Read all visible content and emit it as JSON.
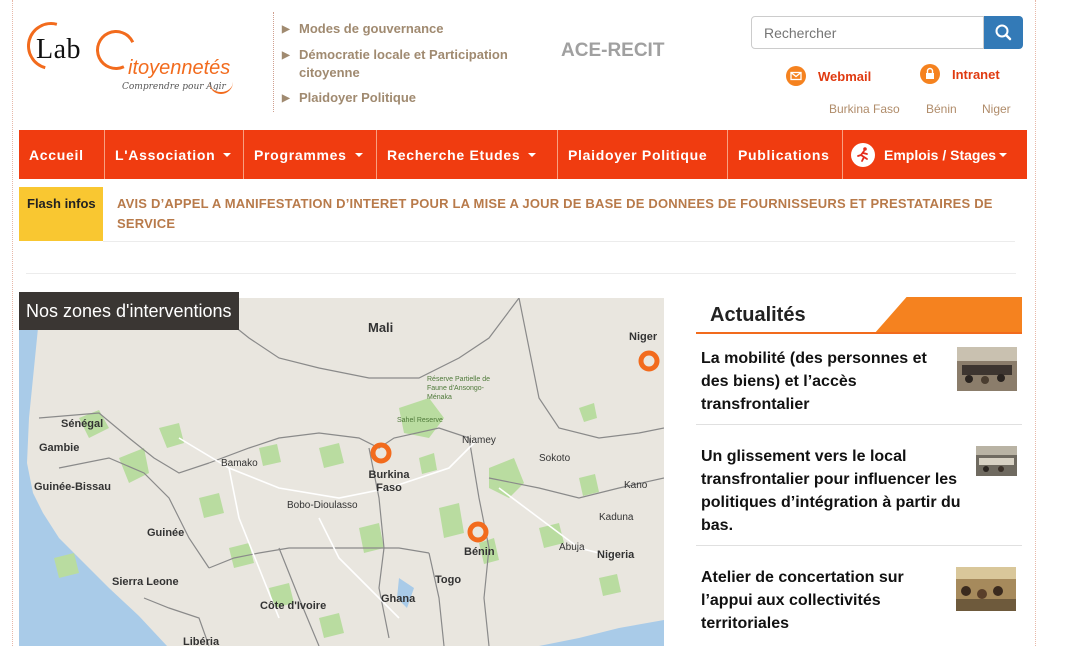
{
  "brand": {
    "logo_lab": "Lab",
    "logo_citoyennetes": "itoyennetés",
    "logo_tagline": "Comprendre pour Agir"
  },
  "top_links": [
    {
      "label": "Modes de gouvernance"
    },
    {
      "label": "Démocratie locale et Participation citoyenne"
    },
    {
      "label": "Plaidoyer Politique"
    }
  ],
  "ace_recit": "ACE-RECIT",
  "search": {
    "placeholder": "Rechercher",
    "icon": "search-icon"
  },
  "webmail": "Webmail",
  "intranet": "Intranet",
  "countries": [
    "Burkina Faso",
    "Bénin",
    "Niger"
  ],
  "nav": {
    "items": [
      {
        "label": "Accueil",
        "dropdown": false
      },
      {
        "label": "L'Association",
        "dropdown": true
      },
      {
        "label": "Programmes",
        "dropdown": true
      },
      {
        "label": "Recherche Etudes",
        "dropdown": true
      },
      {
        "label": "Plaidoyer Politique",
        "dropdown": false
      },
      {
        "label": "Publications",
        "dropdown": false
      },
      {
        "label": "Emplois / Stages",
        "dropdown": true,
        "icon": "runner-icon"
      }
    ],
    "color": "#f03c10"
  },
  "flash": {
    "label": "Flash infos",
    "text": "AVIS D’APPEL A MANIFESTATION D’INTERET POUR LA MISE A JOUR DE BASE DE DONNEES DE FOURNISSEURS ET PRESTATAIRES DE SERVICE"
  },
  "map": {
    "label": "Nos zones d'interventions",
    "places": [
      "Mali",
      "Niger",
      "Sénégal",
      "Gambie",
      "Guinée-Bissau",
      "Guinée",
      "Sierra Leone",
      "Libéria",
      "Côte d'Ivoire",
      "Ghana",
      "Togo",
      "Bénin",
      "Nigeria",
      "Burkina Faso",
      "Niamey",
      "Bamako",
      "Bobo-Dioulasso",
      "Sokoto",
      "Kano",
      "Kaduna",
      "Abuja",
      "Réserve Partielle de Faune d'Ansongo-Ménaka",
      "Sahel Reserve"
    ],
    "markers": [
      "Niger",
      "Burkina Faso",
      "Bénin"
    ],
    "marker_color": "#f26b1d"
  },
  "actualites": {
    "title": "Actualités",
    "items": [
      {
        "title": "La mobilité (des personnes et des biens) et l’accès transfrontalier"
      },
      {
        "title": "Un glissement vers le local transfrontalier pour influencer les politiques d’intégration à partir du bas."
      },
      {
        "title": "Atelier de concertation sur l’appui aux collectivités territoriales"
      }
    ]
  },
  "colors": {
    "accent": "#f26b1d",
    "nav": "#f03c10",
    "flash": "#f9c731",
    "search_button": "#337ab7"
  }
}
